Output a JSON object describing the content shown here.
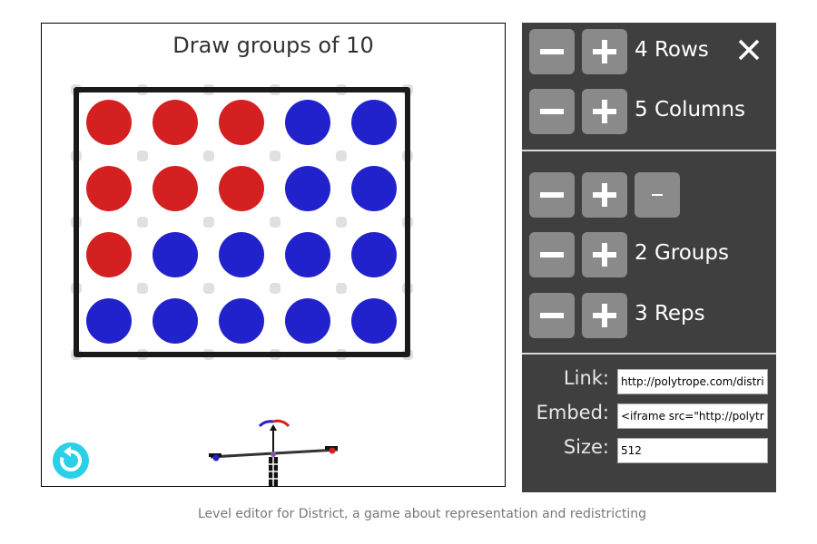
{
  "game": {
    "title": "Draw groups of 10",
    "colors": {
      "red": "#d42020",
      "blue": "#2222cc",
      "border": "#1a1a1a",
      "dot": "#e0e0e0",
      "reset": "#2ad0e6"
    },
    "grid": [
      [
        "red",
        "red",
        "red",
        "blue",
        "blue"
      ],
      [
        "red",
        "red",
        "red",
        "blue",
        "blue"
      ],
      [
        "red",
        "blue",
        "blue",
        "blue",
        "blue"
      ],
      [
        "blue",
        "blue",
        "blue",
        "blue",
        "blue"
      ]
    ]
  },
  "panel": {
    "rows_label": "4 Rows",
    "columns_label": "5 Columns",
    "extra_button_label": "–",
    "groups_label": "2 Groups",
    "reps_label": "3 Reps",
    "link_label": "Link:",
    "link_value": "http://polytrope.com/district/",
    "embed_label": "Embed:",
    "embed_value": "<iframe src=\"http://polytrope",
    "size_label": "Size:",
    "size_value": "512"
  },
  "footer": {
    "caption": "Level editor for District, a game about representation and redistricting"
  }
}
